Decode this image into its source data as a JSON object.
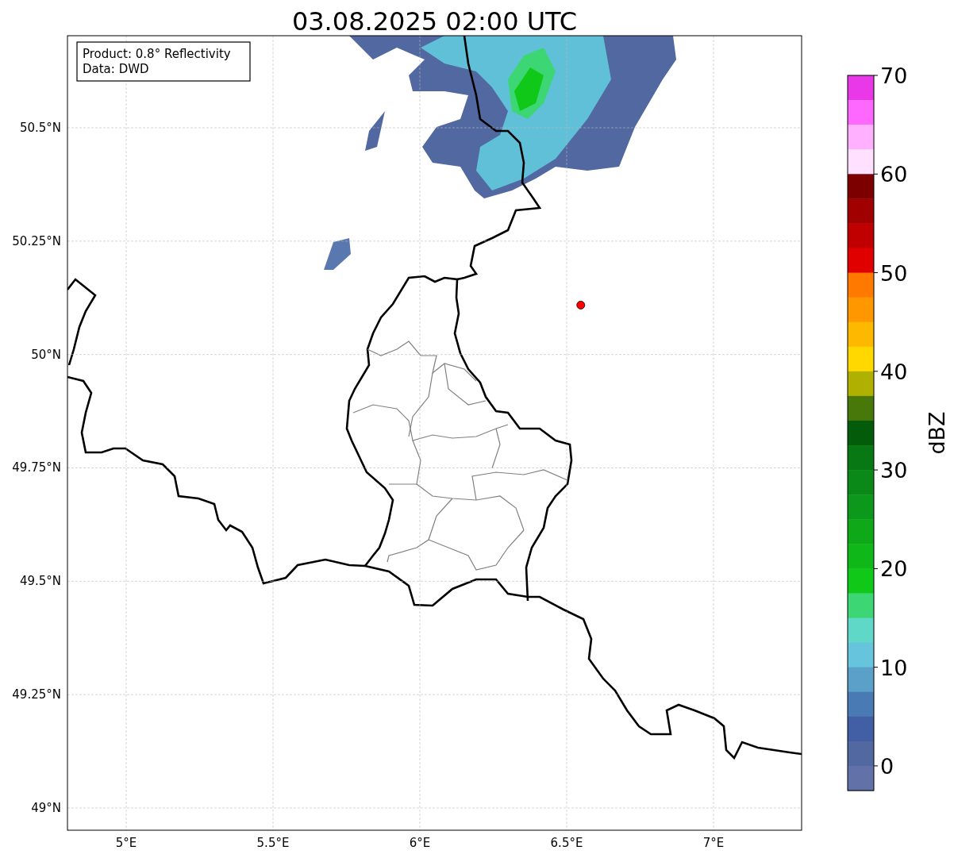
{
  "chart_data": {
    "type": "scatter",
    "title": "03.08.2025 02:00 UTC",
    "grid": true,
    "xlim": [
      4.8,
      7.3
    ],
    "ylim": [
      48.951,
      50.703
    ],
    "xticks": [
      {
        "value": 5,
        "label": "5°E"
      },
      {
        "value": 5.5,
        "label": "5.5°E"
      },
      {
        "value": 6,
        "label": "6°E"
      },
      {
        "value": 6.5,
        "label": "6.5°E"
      },
      {
        "value": 7,
        "label": "7°E"
      }
    ],
    "yticks": [
      {
        "value": 50.5,
        "label": "50.5°N"
      },
      {
        "value": 50.25,
        "label": "50.25°N"
      },
      {
        "value": 50,
        "label": "50°N"
      },
      {
        "value": 49.75,
        "label": "49.75°N"
      },
      {
        "value": 49.5,
        "label": "49.5°N"
      },
      {
        "value": 49.25,
        "label": "49.25°N"
      },
      {
        "value": 49,
        "label": "49°N"
      }
    ],
    "x": [
      6.548
    ],
    "series": [
      {
        "color": "#ff0000",
        "values": [
          50.109
        ]
      }
    ]
  },
  "info_box": [
    "Product: 0.8° Reflectivity",
    "Data: DWD"
  ],
  "colorbar": {
    "label": "dBZ",
    "ticks": [
      "70",
      "60",
      "50",
      "40",
      "30",
      "20",
      "10",
      "0"
    ],
    "bands": [
      {
        "color": "#e838e8"
      },
      {
        "color": "#ff68ff"
      },
      {
        "color": "#ffb0ff"
      },
      {
        "color": "#ffe0ff"
      },
      {
        "color": "#7c0000"
      },
      {
        "color": "#a00000"
      },
      {
        "color": "#c00000"
      },
      {
        "color": "#e00000"
      },
      {
        "color": "#ff7800"
      },
      {
        "color": "#ff9800"
      },
      {
        "color": "#ffb800"
      },
      {
        "color": "#ffd800"
      },
      {
        "color": "#b0b000"
      },
      {
        "color": "#48780a"
      },
      {
        "color": "#045c0a"
      },
      {
        "color": "#087815"
      },
      {
        "color": "#0a8818"
      },
      {
        "color": "#0c981a"
      },
      {
        "color": "#0ea818"
      },
      {
        "color": "#0fb818"
      },
      {
        "color": "#10c818"
      },
      {
        "color": "#3cd674"
      },
      {
        "color": "#60d8c8"
      },
      {
        "color": "#66c4dc"
      },
      {
        "color": "#5aa0c8"
      },
      {
        "color": "#4a7ab4"
      },
      {
        "color": "#425ea4"
      },
      {
        "color": "#5268a0"
      },
      {
        "color": "#6272a8"
      }
    ]
  }
}
